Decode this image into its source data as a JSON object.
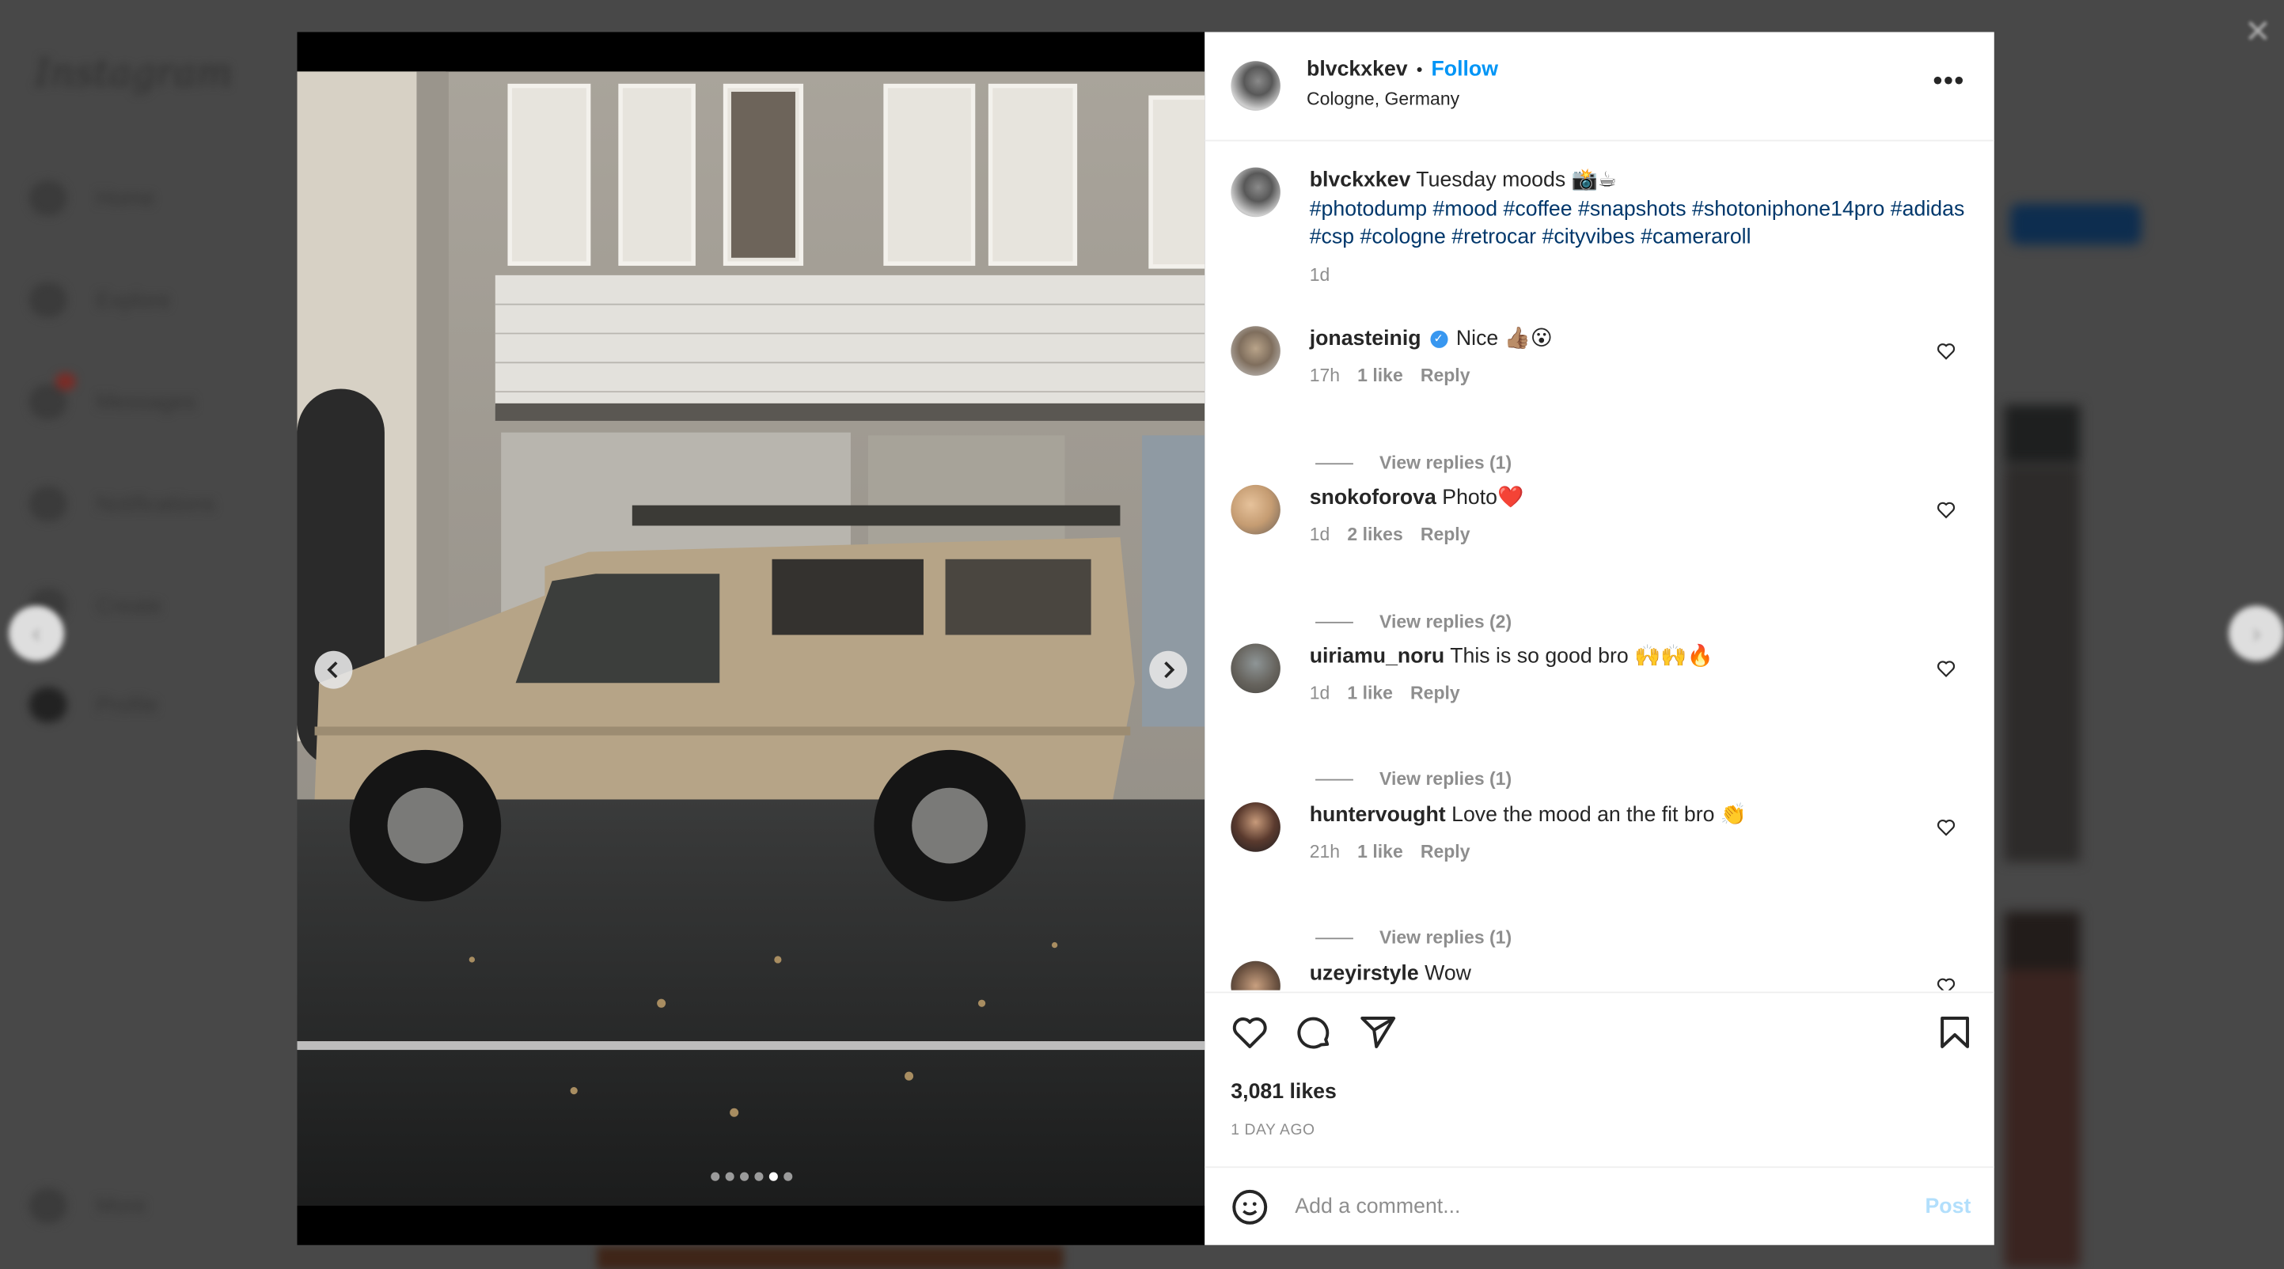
{
  "background": {
    "logo": "Instagram",
    "nav": [
      {
        "label": "Home",
        "icon": "home-icon"
      },
      {
        "label": "Explore",
        "icon": "explore-icon"
      },
      {
        "label": "Messages",
        "icon": "messages-icon",
        "badge": true
      },
      {
        "label": "Notifications",
        "icon": "heart-icon"
      },
      {
        "label": "Create",
        "icon": "create-icon"
      },
      {
        "label": "Profile",
        "icon": "profile-icon"
      },
      {
        "label": "More",
        "icon": "menu-icon"
      }
    ]
  },
  "close_label": "✕",
  "carousel": {
    "total": 6,
    "active_index": 4
  },
  "post": {
    "username": "blvckxkev",
    "separator": "•",
    "follow_label": "Follow",
    "location": "Cologne, Germany",
    "more_label": "•••",
    "caption": {
      "username": "blvckxkev",
      "text": "Tuesday moods 📸☕",
      "hashtags": [
        "#photodump",
        "#mood",
        "#coffee",
        "#snapshots",
        "#shotoniphone14pro",
        "#adidas",
        "#csp",
        "#cologne",
        "#retrocar",
        "#cityvibes",
        "#cameraroll"
      ],
      "time": "1d"
    },
    "comments": [
      {
        "username": "jonasteinig",
        "verified": true,
        "text": "Nice 👍🏽😮",
        "time": "17h",
        "likes": "1 like",
        "reply": "Reply",
        "view_replies": "View replies (1)"
      },
      {
        "username": "snokoforova",
        "verified": false,
        "text": "Photo❤️",
        "time": "1d",
        "likes": "2 likes",
        "reply": "Reply",
        "view_replies": "View replies (2)"
      },
      {
        "username": "uiriamu_noru",
        "verified": false,
        "text": "This is so good bro 🙌🙌🔥",
        "time": "1d",
        "likes": "1 like",
        "reply": "Reply",
        "view_replies": "View replies (1)"
      },
      {
        "username": "huntervought",
        "verified": false,
        "text": "Love the mood an the fit bro 👏",
        "time": "21h",
        "likes": "1 like",
        "reply": "Reply",
        "view_replies": "View replies (1)"
      },
      {
        "username": "uzeyirstyle",
        "verified": false,
        "text": "Wow"
      }
    ],
    "likes": "3,081 likes",
    "posted": "1 DAY AGO",
    "comment_placeholder": "Add a comment...",
    "post_label": "Post"
  },
  "colors": {
    "follow": "#0095f6",
    "hashtag": "#00376b",
    "post_disabled": "#b2dffc",
    "verified": "#3897f0"
  }
}
